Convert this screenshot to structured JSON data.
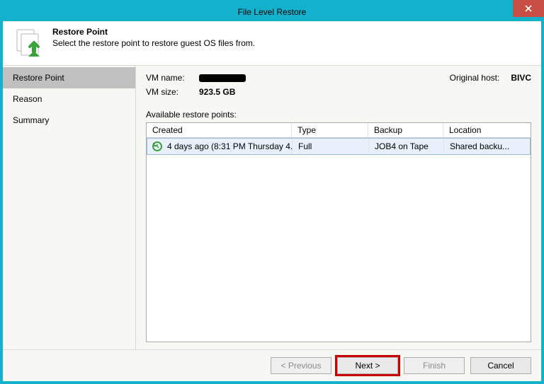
{
  "window": {
    "title": "File Level Restore"
  },
  "header": {
    "title": "Restore Point",
    "subtitle": "Select the restore point to restore guest OS files from."
  },
  "nav": {
    "items": [
      {
        "label": "Restore Point",
        "active": true
      },
      {
        "label": "Reason",
        "active": false
      },
      {
        "label": "Summary",
        "active": false
      }
    ]
  },
  "info": {
    "vm_name_label": "VM name:",
    "vm_name_value": "",
    "vm_size_label": "VM size:",
    "vm_size_value": "923.5 GB",
    "orig_host_label": "Original host:",
    "orig_host_value": "BIVC"
  },
  "grid": {
    "label": "Available restore points:",
    "columns": {
      "created": "Created",
      "type": "Type",
      "backup": "Backup",
      "location": "Location"
    },
    "rows": [
      {
        "created": "4 days ago (8:31 PM Thursday 4...",
        "type": "Full",
        "backup": "JOB4 on Tape",
        "location": "Shared backu..."
      }
    ]
  },
  "buttons": {
    "previous": "< Previous",
    "next": "Next >",
    "finish": "Finish",
    "cancel": "Cancel"
  }
}
